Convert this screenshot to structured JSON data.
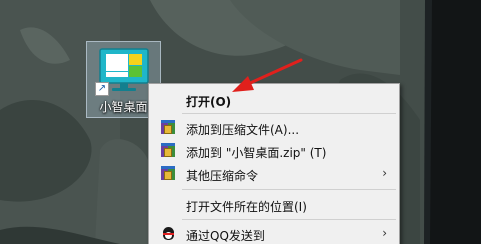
{
  "desktop": {
    "icon_label": "小智桌面",
    "icon_name": "app-shortcut-icon",
    "shortcut_overlay": "↗"
  },
  "context_menu": {
    "items": [
      {
        "label": "打开(O)",
        "bold": true,
        "icon": null,
        "has_submenu": false
      },
      {
        "label": "添加到压缩文件(A)...",
        "bold": false,
        "icon": "archive-icon",
        "has_submenu": false
      },
      {
        "label": "添加到 \"小智桌面.zip\" (T)",
        "bold": false,
        "icon": "archive-icon",
        "has_submenu": false
      },
      {
        "label": "其他压缩命令",
        "bold": false,
        "icon": "archive-icon",
        "has_submenu": true
      },
      {
        "label": "打开文件所在的位置(I)",
        "bold": false,
        "icon": null,
        "has_submenu": false
      },
      {
        "label": "通过QQ发送到",
        "bold": false,
        "icon": "qq-icon",
        "has_submenu": true
      }
    ],
    "submenu_glyph": "›"
  },
  "annotation": {
    "color": "#e0201c",
    "shape": "arrow pointing to the Open menu item"
  },
  "colors": {
    "menu_background": "#f0f0f0",
    "selection_tint": "#b9d2e6",
    "app_icon_teal": "#1fb6c9",
    "app_tile_yellow": "#f5d21c",
    "app_tile_green": "#5bc236"
  }
}
